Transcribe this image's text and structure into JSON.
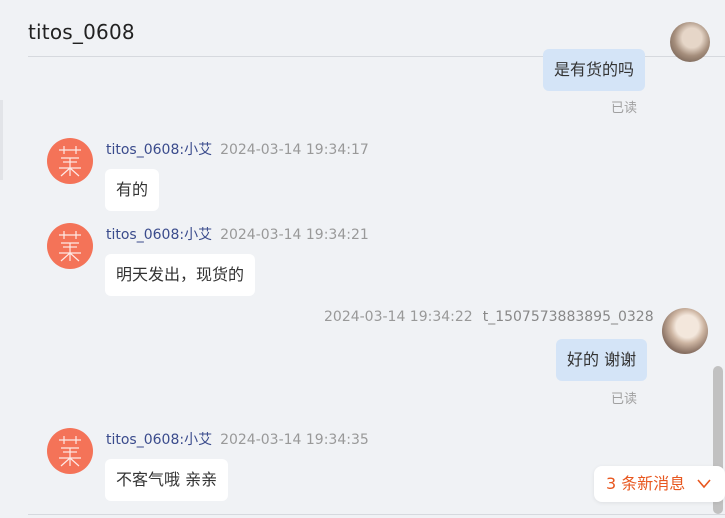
{
  "header": {
    "title": "titos_0608"
  },
  "messages": [
    {
      "direction": "out",
      "text": "是有货的吗",
      "read_label": "已读"
    },
    {
      "direction": "in",
      "sender": "titos_0608:小艾",
      "time": "2024-03-14 19:34:17",
      "text": "有的"
    },
    {
      "direction": "in",
      "sender": "titos_0608:小艾",
      "time": "2024-03-14 19:34:21",
      "text": "明天发出，现货的"
    },
    {
      "direction": "out",
      "sender": "t_1507573883895_0328",
      "time": "2024-03-14 19:34:22",
      "text": "好的 谢谢",
      "read_label": "已读"
    },
    {
      "direction": "in",
      "sender": "titos_0608:小艾",
      "time": "2024-03-14 19:34:35",
      "text": "不客气哦 亲亲"
    }
  ],
  "new_messages_label": "3 条新消息",
  "icons": {
    "shop_avatar": "shop-logo-avatar-icon",
    "user_avatar": "user-photo-avatar-icon",
    "chevron": "chevron-down-icon"
  },
  "colors": {
    "background": "#f0f2f5",
    "outgoing_bubble": "#d4e4f7",
    "incoming_bubble": "#ffffff",
    "sender_name": "#3a4b8c",
    "shop_avatar": "#f47358",
    "new_message_text": "#e8571f"
  }
}
